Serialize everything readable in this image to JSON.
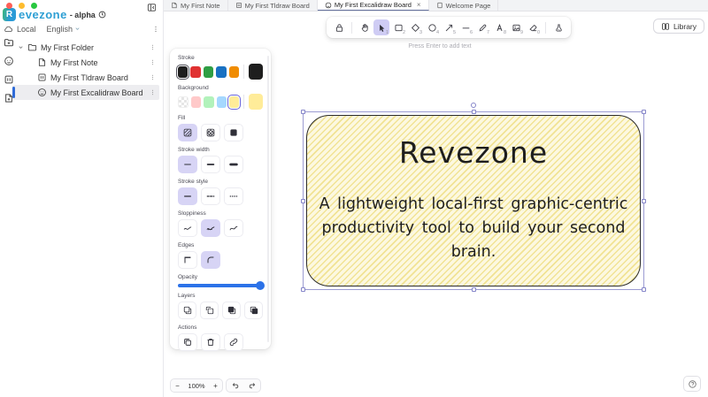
{
  "colors": {
    "traffic_red": "#ff5f57",
    "traffic_yellow": "#febc2e",
    "traffic_green": "#28c840",
    "accent": "#6965db",
    "slider_blue": "#2c72e8",
    "brand_blue": "#2e9fd4"
  },
  "brand": {
    "badge_letter": "R",
    "name": "evezone",
    "suffix": "- alpha"
  },
  "sidebar": {
    "storage_label": "Local",
    "language_label": "English",
    "tree": [
      {
        "label": "My First Folder",
        "type": "folder"
      },
      {
        "label": "My First Note",
        "type": "note"
      },
      {
        "label": "My First Tldraw Board",
        "type": "tldraw"
      },
      {
        "label": "My First Excalidraw Board",
        "type": "excalidraw",
        "selected": true
      }
    ]
  },
  "tabs": [
    {
      "label": "My First Note"
    },
    {
      "label": "My First Tldraw Board"
    },
    {
      "label": "My First Excalidraw Board",
      "active": true,
      "close": "×"
    },
    {
      "label": "Welcome Page"
    }
  ],
  "toolbar": {
    "tools": [
      {
        "name": "lock"
      },
      {
        "name": "hand"
      },
      {
        "name": "selection",
        "shortcut": "1",
        "active": true
      },
      {
        "name": "rectangle",
        "shortcut": "2"
      },
      {
        "name": "diamond",
        "shortcut": "3"
      },
      {
        "name": "ellipse",
        "shortcut": "4"
      },
      {
        "name": "arrow",
        "shortcut": "5"
      },
      {
        "name": "line",
        "shortcut": "6"
      },
      {
        "name": "draw",
        "shortcut": "7"
      },
      {
        "name": "text",
        "shortcut": "8"
      },
      {
        "name": "image",
        "shortcut": "9"
      },
      {
        "name": "eraser",
        "shortcut": "0"
      },
      {
        "name": "more-tools"
      }
    ],
    "library_label": "Library"
  },
  "hint": "Press Enter to add text",
  "style_panel": {
    "stroke": {
      "label": "Stroke",
      "colors": [
        "#1e1e1e",
        "#e03131",
        "#2f9e44",
        "#1971c2",
        "#f08c00"
      ],
      "current": "#1e1e1e"
    },
    "background": {
      "label": "Background",
      "colors": [
        "transparent",
        "#ffc9c9",
        "#b2f2bb",
        "#a5d8ff",
        "#ffec99"
      ],
      "current": "#ffec99"
    },
    "fill": {
      "label": "Fill"
    },
    "stroke_width": {
      "label": "Stroke width"
    },
    "stroke_style": {
      "label": "Stroke style"
    },
    "sloppiness": {
      "label": "Sloppiness"
    },
    "edges": {
      "label": "Edges"
    },
    "opacity": {
      "label": "Opacity",
      "value": 100
    },
    "layers": {
      "label": "Layers"
    },
    "actions": {
      "label": "Actions"
    }
  },
  "canvas_shape": {
    "title": "Revezone",
    "description": "A lightweight local-first graphic-centric productivity tool to build your second brain."
  },
  "footer": {
    "zoom_value": "100%",
    "zoom_out": "−",
    "zoom_in": "+"
  }
}
